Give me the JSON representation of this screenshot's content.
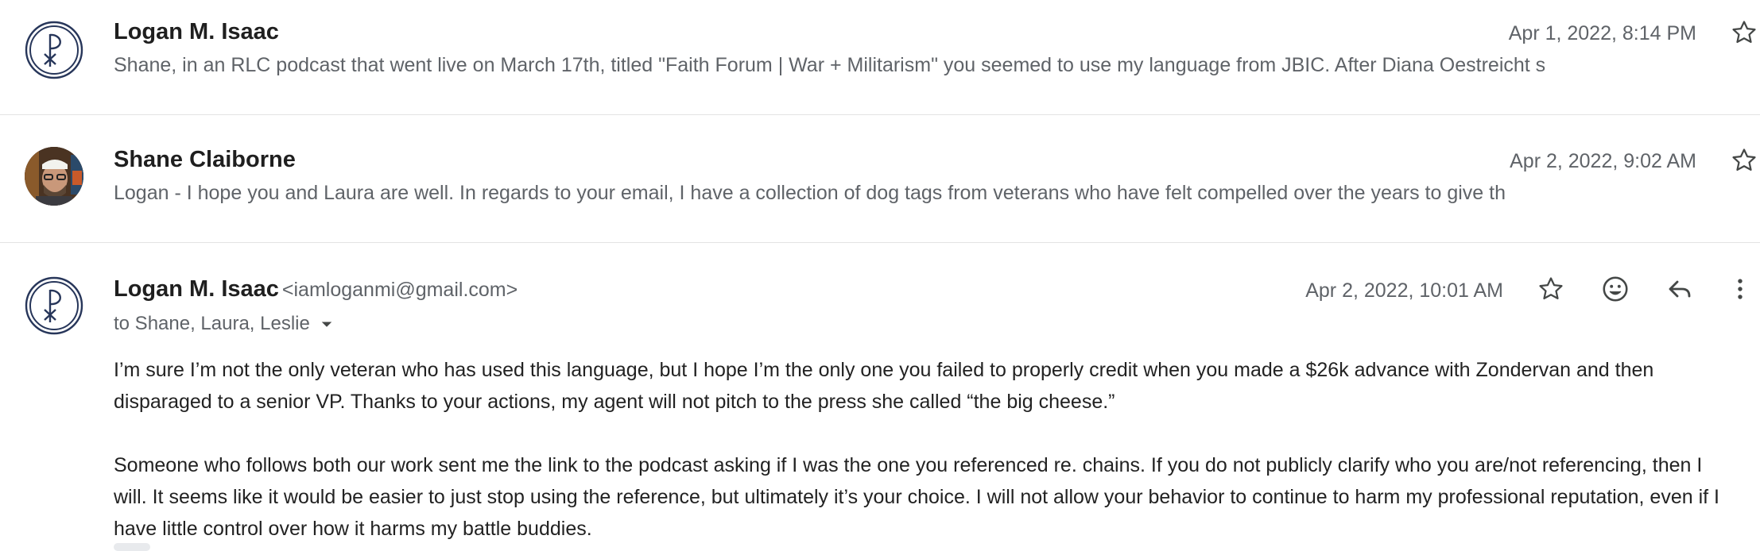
{
  "messages": [
    {
      "sender": "Logan M. Isaac",
      "date": "Apr 1, 2022, 8:14 PM",
      "snippet": "Shane, in an RLC podcast that went live on March 17th, titled \"Faith Forum | War + Militarism\" you seemed to use my language from JBIC. After Diana Oestreicht s"
    },
    {
      "sender": "Shane Claiborne",
      "date": "Apr 2, 2022, 9:02 AM",
      "snippet": "Logan - I hope you and Laura are well. In regards to your email, I have a collection of dog tags from veterans who have felt compelled over the years to give th"
    },
    {
      "sender": "Logan M. Isaac",
      "email": "<iamloganmi@gmail.com>",
      "date": "Apr 2, 2022, 10:01 AM",
      "to": "to Shane, Laura, Leslie",
      "body": [
        "I’m sure I’m not the only veteran who has used this language, but I hope I’m the only one you failed to properly credit when you made a $26k advance with Zondervan and then disparaged to a senior VP. Thanks to your actions, my agent will not pitch to the press she called “the big cheese.”",
        "Someone who follows both our work sent me the link to the podcast asking if I was the one you referenced re. chains. If you do not publicly clarify who you are/not referencing, then I will. It seems like it would be easier to just stop using the reference, but ultimately it’s your choice. I will not allow your behavior to continue to harm my professional reputation, even if I have little control over how it harms my battle buddies."
      ]
    }
  ],
  "icons": {
    "star": "star-outline-icon",
    "emoji": "emoji-reaction-icon",
    "reply": "reply-icon",
    "more": "more-vert-icon",
    "dropdown": "caret-down-icon",
    "chi_rho": "chi-rho-logo"
  },
  "colors": {
    "logo_navy": "#27365a",
    "text_primary": "#1f1f1f",
    "text_secondary": "#5f6368",
    "icon_gray": "#444746",
    "divider": "#e3e3e3"
  }
}
